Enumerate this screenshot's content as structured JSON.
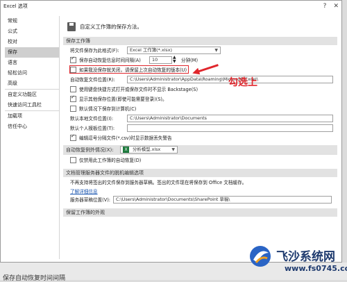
{
  "window": {
    "title": "Excel 选项",
    "help": "?",
    "close": "✕"
  },
  "sidebar": {
    "items": [
      "常规",
      "公式",
      "校对",
      "保存",
      "语言",
      "轻松访问",
      "高级",
      "自定义功能区",
      "快速访问工具栏",
      "加载项",
      "信任中心"
    ],
    "selected": "保存"
  },
  "header": {
    "title": "自定义工作簿的保存方法。"
  },
  "sections": {
    "save": "保存工作簿",
    "autorecover_exceptions": "自动恢复例外情况(X):",
    "offline": "文档管理服务器文件的脱机编辑选项",
    "preserve": "保留工作簿的外观"
  },
  "save": {
    "format_label": "将文件保存为此格式(F):",
    "format_value": "Excel 工作簿(*.xlsx)",
    "autorecover_label": "保存自动恢复信息时间间隔(A)",
    "autorecover_value": "10",
    "minutes_label": "分钟(M)",
    "keep_last_label": "如果我没保存就关闭，请保留上次自动恢复的版本(U)",
    "autorecover_location_label": "自动恢复文件位置(R):",
    "autorecover_location_value": "C:\\Users\\Administrator\\AppData\\Roaming\\Microsoft\\Excel\\",
    "backstage_label": "使用键盘快捷方式打开或保存文件时不显示 Backstage(S)",
    "show_more_label": "显示其他保存位置(即使可能需要登录)(S)。",
    "default_computer_label": "默认情况下保存到计算机(C)",
    "default_local_label": "默认本地文件位置(I):",
    "default_local_value": "C:\\Users\\Administrator\\Documents",
    "default_template_label": "默认个人模板位置(T):",
    "default_template_value": "",
    "csv_warning_label": "编辑逗号分隔文件(*.csv)时显示数据丢失警告"
  },
  "autorecover_exceptions": {
    "workbook": "分析模型.xlsx",
    "disable_label": "仅禁用此工作簿的自动恢复(D)"
  },
  "offline": {
    "notice": "不再支持将签出的文件保存到服务器草稿。签出的文件现在将保存到 Office 文档缓存。",
    "learn_more": "了解详细信息",
    "drafts_label": "服务器草稿位置(V):",
    "drafts_value": "C:\\Users\\Administrator\\Documents\\SharePoint 草稿\\"
  },
  "annotation": {
    "callout": "勾选上"
  },
  "watermark": {
    "name": "飞沙系统网",
    "url": "www.fs0745.com"
  },
  "background": {
    "text": "保存自动恢复时间间隔"
  },
  "colors": {
    "accent": "#e0262c",
    "selected": "#cfcfcf"
  }
}
